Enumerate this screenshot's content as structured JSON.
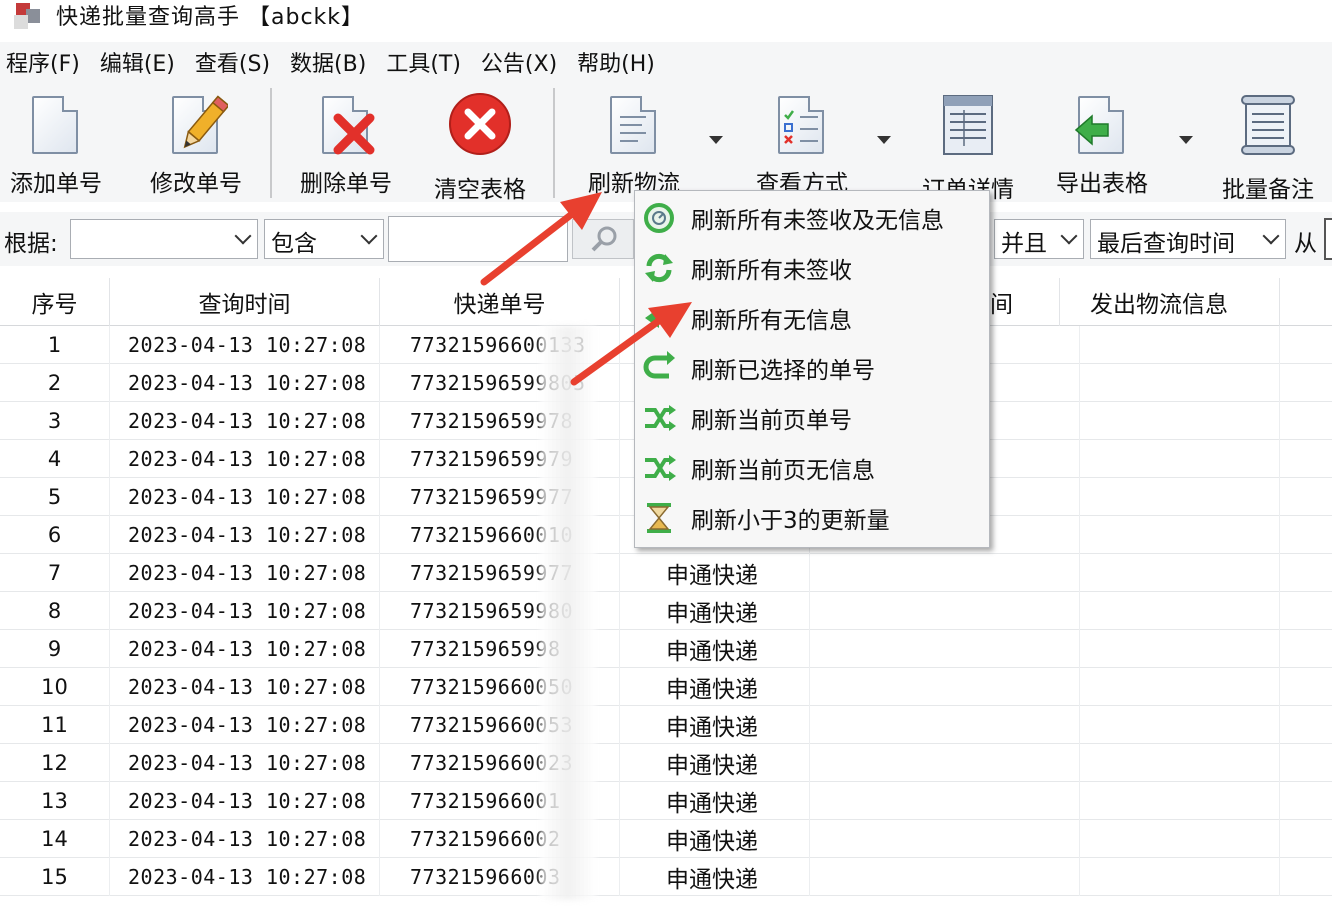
{
  "window": {
    "title": "快递批量查询高手 【abckk】"
  },
  "menu": [
    "程序(F)",
    "编辑(E)",
    "查看(S)",
    "数据(B)",
    "工具(T)",
    "公告(X)",
    "帮助(H)"
  ],
  "toolbar": {
    "add": "添加单号",
    "edit": "修改单号",
    "delete": "删除单号",
    "clear": "清空表格",
    "refresh": "刷新物流",
    "view": "查看方式",
    "detail": "订单详情",
    "export": "导出表格",
    "note": "批量备注"
  },
  "filter": {
    "label": "根据:",
    "field_value": "",
    "op_value": "包含",
    "text_value": "",
    "logic_value": "并且",
    "time_field": "最后查询时间",
    "from_label": "从"
  },
  "table": {
    "headers": [
      "序号",
      "查询时间",
      "快递单号",
      "间",
      "发出物流信息"
    ],
    "rows": [
      {
        "no": "1",
        "time": "2023-04-13  10:27:08",
        "tracking": "77321596600133",
        "carrier": ""
      },
      {
        "no": "2",
        "time": "2023-04-13  10:27:08",
        "tracking": "77321596599805",
        "carrier": ""
      },
      {
        "no": "3",
        "time": "2023-04-13  10:27:08",
        "tracking": "7732159659978",
        "carrier": ""
      },
      {
        "no": "4",
        "time": "2023-04-13  10:27:08",
        "tracking": "7732159659979",
        "carrier": ""
      },
      {
        "no": "5",
        "time": "2023-04-13  10:27:08",
        "tracking": "7732159659977",
        "carrier": ""
      },
      {
        "no": "6",
        "time": "2023-04-13  10:27:08",
        "tracking": "7732159660010",
        "carrier": ""
      },
      {
        "no": "7",
        "time": "2023-04-13  10:27:08",
        "tracking": "7732159659977",
        "carrier": "申通快递"
      },
      {
        "no": "8",
        "time": "2023-04-13  10:27:08",
        "tracking": "7732159659980",
        "carrier": "申通快递"
      },
      {
        "no": "9",
        "time": "2023-04-13  10:27:08",
        "tracking": "773215965998",
        "carrier": "申通快递"
      },
      {
        "no": "10",
        "time": "2023-04-13  10:27:08",
        "tracking": "7732159660050",
        "carrier": "申通快递"
      },
      {
        "no": "11",
        "time": "2023-04-13  10:27:08",
        "tracking": "7732159660053",
        "carrier": "申通快递"
      },
      {
        "no": "12",
        "time": "2023-04-13  10:27:08",
        "tracking": "7732159660023",
        "carrier": "申通快递"
      },
      {
        "no": "13",
        "time": "2023-04-13  10:27:08",
        "tracking": "773215966001",
        "carrier": "申通快递"
      },
      {
        "no": "14",
        "time": "2023-04-13  10:27:08",
        "tracking": "773215966002",
        "carrier": "申通快递"
      },
      {
        "no": "15",
        "time": "2023-04-13  10:27:08",
        "tracking": "773215966003",
        "carrier": "申通快递"
      }
    ]
  },
  "dropdown": {
    "items": [
      {
        "label": "刷新所有未签收及无信息",
        "icon": "clock-refresh-icon"
      },
      {
        "label": "刷新所有未签收",
        "icon": "green-refresh-icon"
      },
      {
        "label": "刷新所有无信息",
        "icon": "green-arrow-icon"
      },
      {
        "label": "刷新已选择的单号",
        "icon": "green-undo-icon"
      },
      {
        "label": "刷新当前页单号",
        "icon": "shuffle-icon"
      },
      {
        "label": "刷新当前页无信息",
        "icon": "shuffle-icon"
      },
      {
        "label": "刷新小于3的更新量",
        "icon": "hourglass-icon"
      }
    ]
  },
  "colors": {
    "arrow": "#e8402f",
    "accent_green": "#3fae49",
    "delete_red": "#e2302a"
  }
}
